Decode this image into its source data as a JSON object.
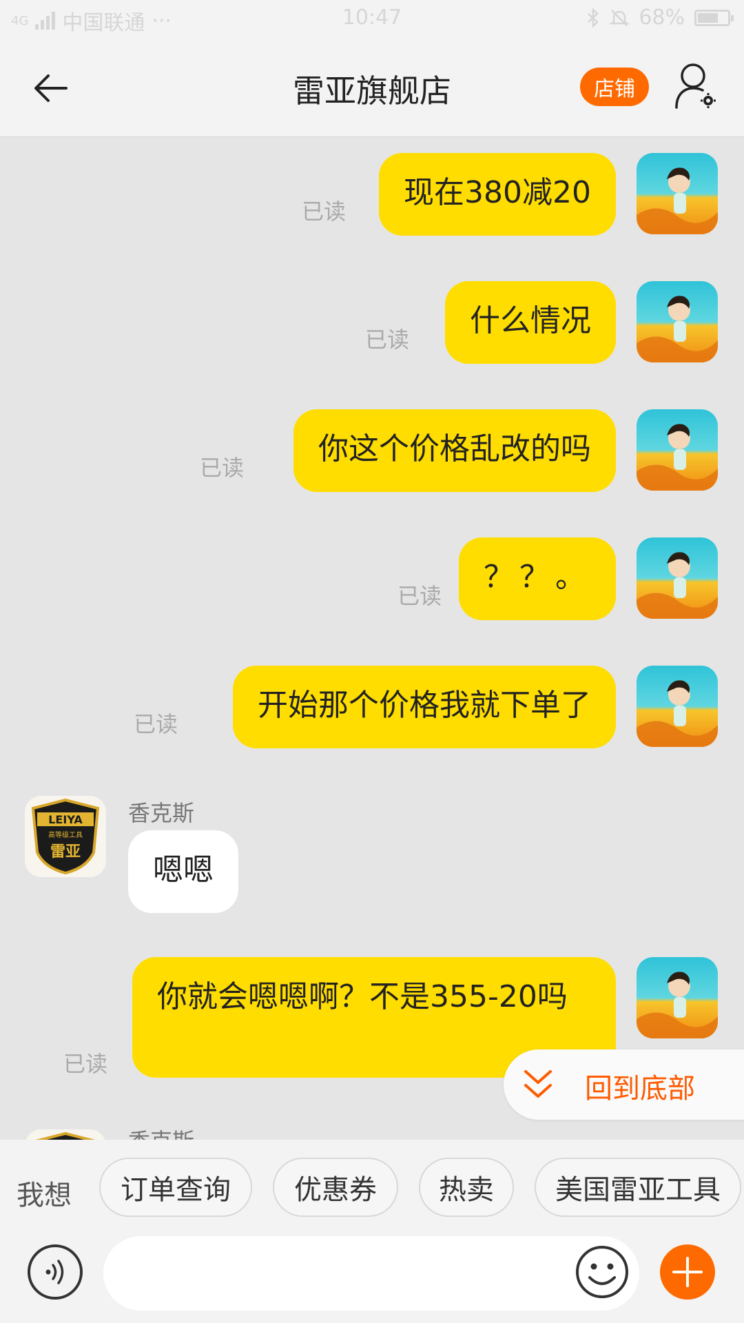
{
  "status_bar": {
    "network": "4G",
    "carrier": "中国联通",
    "dots": "···",
    "time": "10:47",
    "battery": "68%",
    "battery_level": 0.68
  },
  "header": {
    "title": "雷亚旗舰店",
    "shop_button": "店铺"
  },
  "messages": {
    "m1": {
      "text": "现在380减20",
      "status": "已读"
    },
    "m2": {
      "text": "什么情况",
      "status": "已读"
    },
    "m3": {
      "text": "你这个价格乱改的吗",
      "status": "已读"
    },
    "m4": {
      "text": "？？。",
      "status": "已读"
    },
    "m5": {
      "text": "开始那个价格我就下单了",
      "status": "已读"
    },
    "s1": {
      "sender": "香克斯",
      "text": "嗯嗯"
    },
    "m6": {
      "text": "你就会嗯嗯啊？不是355-20吗",
      "status": "已读"
    },
    "s2": {
      "sender": "香克斯"
    }
  },
  "shop_logo": {
    "line1": "LEIYA",
    "line2": "高等级工具",
    "line3": "雷亚"
  },
  "back_to_bottom": "回到底部",
  "quick_bar": {
    "prefix": "我想",
    "chips": [
      "订单查询",
      "优惠券",
      "热卖",
      "美国雷亚工具"
    ]
  },
  "input": {
    "placeholder": ""
  },
  "colors": {
    "accent": "#ff6a00",
    "my_bubble": "#ffdd00",
    "shop_bubble": "#ffffff",
    "background": "#e5e5e5"
  }
}
